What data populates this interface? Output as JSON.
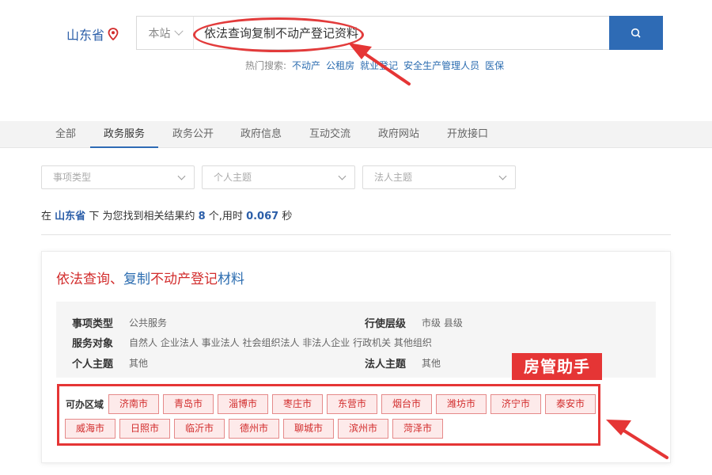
{
  "header": {
    "region": "山东省",
    "scope": "本站",
    "query": "依法查询复制不动产登记资料",
    "hot_label": "热门搜索:",
    "hot_links": [
      "不动产",
      "公租房",
      "就业登记",
      "安全生产管理人员",
      "医保"
    ]
  },
  "tabs": [
    "全部",
    "政务服务",
    "政务公开",
    "政府信息",
    "互动交流",
    "政府网站",
    "开放接口"
  ],
  "active_tab": "政务服务",
  "filters": [
    {
      "placeholder": "事项类型"
    },
    {
      "placeholder": "个人主题"
    },
    {
      "placeholder": "法人主题"
    }
  ],
  "result": {
    "pre": "在",
    "region": "山东省",
    "mid": "下 为您找到相关结果约",
    "count": "8",
    "mid2": "个,用时",
    "time": "0.067",
    "post": "秒"
  },
  "card": {
    "title_parts": [
      {
        "text": "依法查询",
        "color": "red"
      },
      {
        "text": "、",
        "color": "red"
      },
      {
        "text": "复制",
        "color": "blue"
      },
      {
        "text": "不动产登记",
        "color": "red"
      },
      {
        "text": "材料",
        "color": "blue"
      }
    ],
    "fields": [
      {
        "label": "事项类型",
        "value": "公共服务"
      },
      {
        "label": "行使层级",
        "value": "市级 县级"
      },
      {
        "label": "服务对象",
        "value": "自然人 企业法人 事业法人 社会组织法人 非法人企业 行政机关 其他组织"
      },
      {
        "label": "个人主题",
        "value": "其他"
      },
      {
        "label": "法人主题",
        "value": "其他"
      }
    ],
    "area_label": "可办区域",
    "cities": [
      "济南市",
      "青岛市",
      "淄博市",
      "枣庄市",
      "东营市",
      "烟台市",
      "潍坊市",
      "济宁市",
      "泰安市",
      "威海市",
      "日照市",
      "临沂市",
      "德州市",
      "聊城市",
      "滨州市",
      "菏泽市"
    ]
  },
  "badge": "房管助手",
  "colors": {
    "accent": "#2e6bb5",
    "annotation": "#e53535"
  }
}
